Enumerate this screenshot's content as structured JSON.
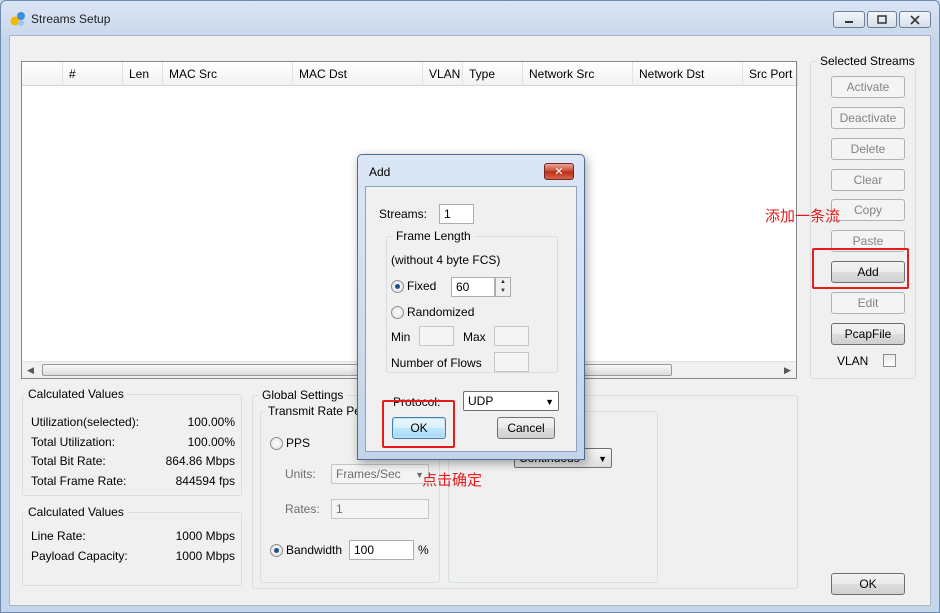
{
  "window": {
    "title": "Streams Setup"
  },
  "streams_table": {
    "columns": [
      "",
      "#",
      "Len",
      "MAC Src",
      "MAC Dst",
      "VLAN",
      "Type",
      "Network Src",
      "Network Dst",
      "Src Port"
    ]
  },
  "selected_streams": {
    "title": "Selected Streams",
    "buttons": {
      "activate": "Activate",
      "deactivate": "Deactivate",
      "delete": "Delete",
      "clear": "Clear",
      "copy": "Copy",
      "paste": "Paste",
      "add": "Add",
      "edit": "Edit",
      "pcapfile": "PcapFile"
    },
    "vlan_label": "VLAN"
  },
  "calc1": {
    "title": "Calculated Values",
    "rows": [
      {
        "label": "Utilization(selected):",
        "value": "100.00%"
      },
      {
        "label": "Total Utilization:",
        "value": "100.00%"
      },
      {
        "label": "Total Bit Rate:",
        "value": "864.86 Mbps"
      },
      {
        "label": "Total Frame Rate:",
        "value": "844594 fps"
      }
    ]
  },
  "calc2": {
    "title": "Calculated Values",
    "rows": [
      {
        "label": "Line Rate:",
        "value": "1000 Mbps"
      },
      {
        "label": "Payload Capacity:",
        "value": "1000 Mbps"
      }
    ]
  },
  "global_settings": {
    "title": "Global Settings",
    "transmit_rate_title": "Transmit Rate Per",
    "pps_label": "PPS",
    "units_label": "Units:",
    "units_value": "Frames/Sec",
    "rates_label": "Rates:",
    "rates_value": "1",
    "bandwidth_label": "Bandwidth",
    "bandwidth_value": "100",
    "bandwidth_unit": "%",
    "combo_value": "Continuous"
  },
  "main_ok": "OK",
  "add_dialog": {
    "title": "Add",
    "close": "✕",
    "streams_label": "Streams:",
    "streams_value": "1",
    "frame_length_title": "Frame Length",
    "fcs_note": "(without 4 byte FCS)",
    "fixed_label": "Fixed",
    "fixed_value": "60",
    "randomized_label": "Randomized",
    "min_label": "Min",
    "max_label": "Max",
    "flows_label": "Number of Flows",
    "protocol_label": "Protocol:",
    "protocol_value": "UDP",
    "ok": "OK",
    "cancel": "Cancel"
  },
  "annotations": {
    "add_note": "添加一条流",
    "ok_note": "点击确定"
  },
  "colors": {
    "annotation_red": "#e51c1c",
    "title_bg": "#c6d6ea"
  }
}
